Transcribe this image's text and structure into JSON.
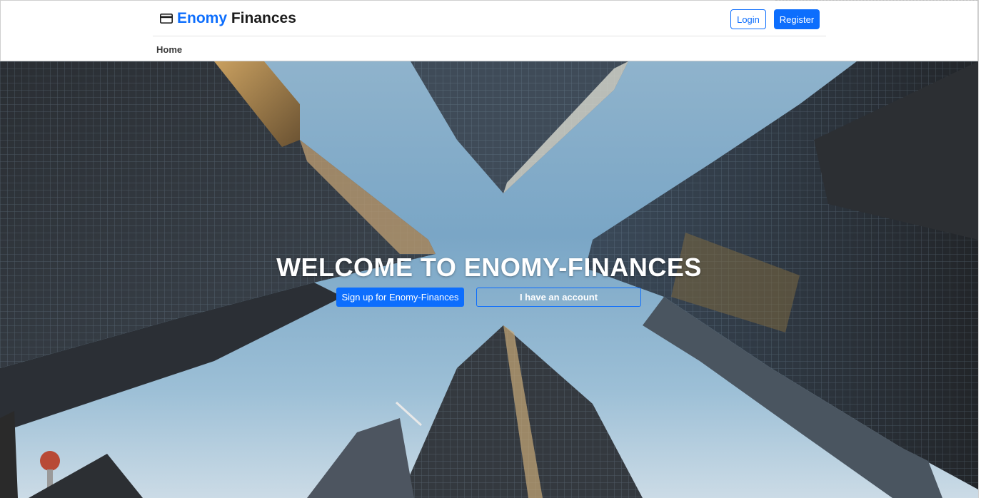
{
  "header": {
    "brand_accent": "Enomy",
    "brand_rest": "Finances",
    "brand_icon": "credit-card-icon",
    "login_label": "Login",
    "register_label": "Register"
  },
  "nav": {
    "home_label": "Home"
  },
  "hero": {
    "title": "WELCOME TO ENOMY-FINANCES",
    "signup_label": "Sign up for Enomy-Finances",
    "account_label": "I have an account"
  },
  "colors": {
    "primary": "#0d6efd",
    "brand_text": "#1c1c1c",
    "hero_text": "#ffffff"
  }
}
